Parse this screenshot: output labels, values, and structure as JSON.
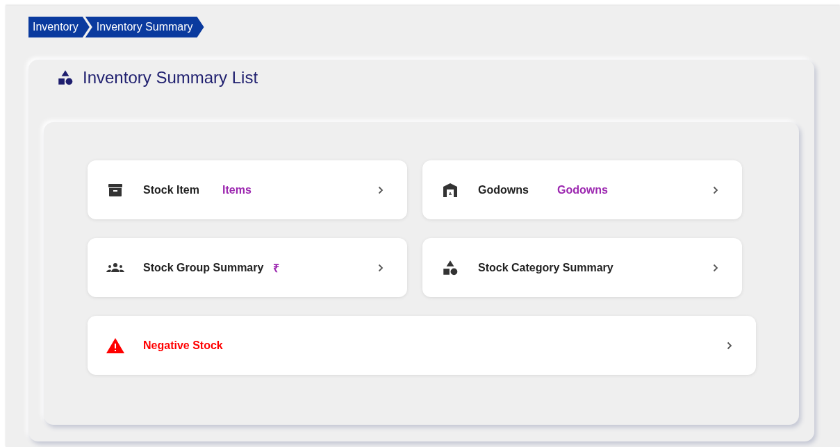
{
  "breadcrumb": [
    {
      "label": "Inventory"
    },
    {
      "label": "Inventory Summary"
    }
  ],
  "panel": {
    "title": "Inventory Summary List"
  },
  "cards": [
    {
      "kind": "box",
      "label": "Stock Item",
      "tag": "Items",
      "wide": false
    },
    {
      "kind": "warehouse",
      "label": "Godowns",
      "tag": "Godowns",
      "wide": false
    },
    {
      "kind": "group",
      "label": "Stock Group Summary",
      "tag": "₹",
      "wide": false
    },
    {
      "kind": "shapes",
      "label": "Stock Category Summary",
      "wide": false
    },
    {
      "kind": "warning",
      "label": "Negative Stock",
      "wide": true
    }
  ]
}
